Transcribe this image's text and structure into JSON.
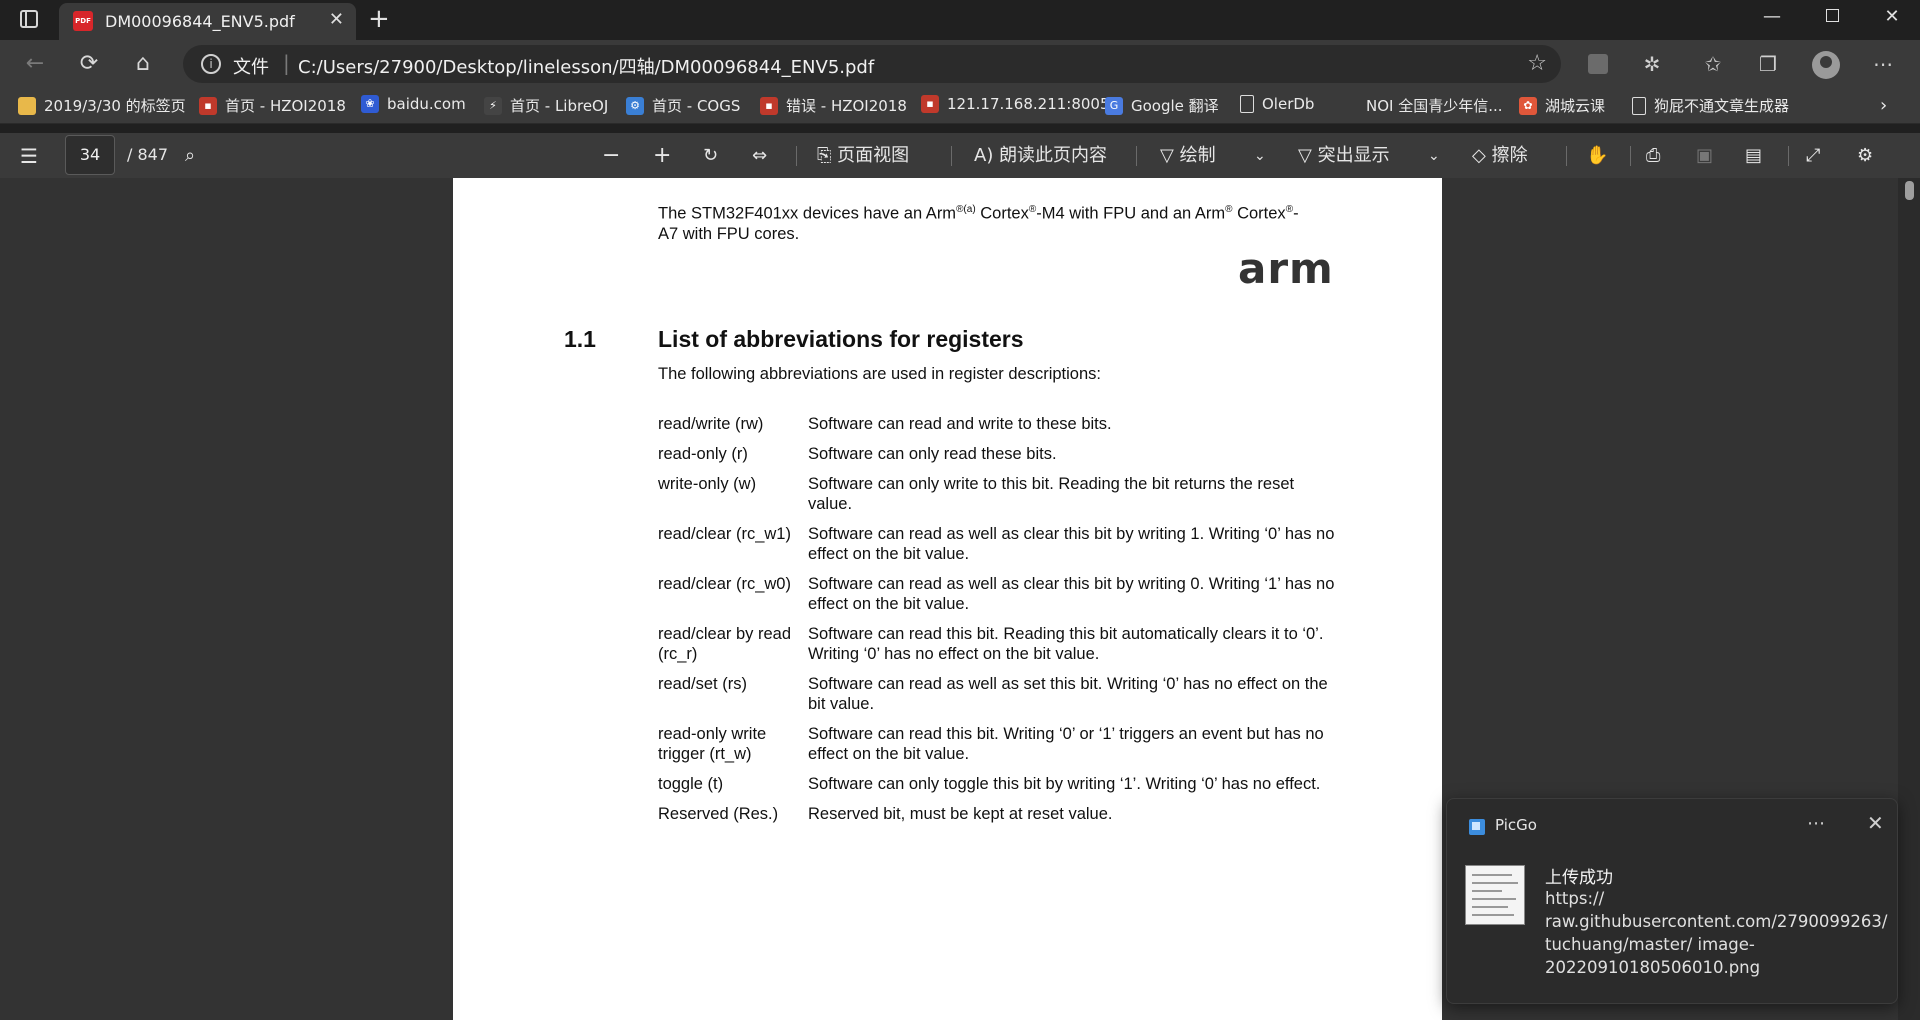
{
  "browser": {
    "tab_title": "DM00096844_ENV5.pdf",
    "address_scheme_label": "文件",
    "address_url": "C:/Users/27900/Desktop/linelesson/四轴/DM00096844_ENV5.pdf"
  },
  "bookmarks": [
    {
      "label": "2019/3/30 的标签页",
      "icon": "folder-icon",
      "color": "#e8b84a"
    },
    {
      "label": "首页 - HZOI2018",
      "icon": "site-favicon",
      "color": "#c0392b"
    },
    {
      "label": "baidu.com",
      "icon": "baidu-icon",
      "color": "#2f5bd3"
    },
    {
      "label": "首页 - LibreOJ",
      "icon": "libreoj-icon",
      "color": "#444444"
    },
    {
      "label": "首页 - COGS",
      "icon": "gear-icon",
      "color": "#3a7fd5"
    },
    {
      "label": "错误 - HZOI2018",
      "icon": "site-favicon",
      "color": "#c0392b"
    },
    {
      "label": "121.17.168.211:8005",
      "icon": "site-favicon",
      "color": "#c0392b"
    },
    {
      "label": "Google 翻译",
      "icon": "google-translate-icon",
      "color": "#4a7be0"
    },
    {
      "label": "OlerDb",
      "icon": "document-icon",
      "color": "#3a3a3a"
    },
    {
      "label": "NOI 全国青少年信...",
      "icon": "noi-icon",
      "color": "#3a3a3a"
    },
    {
      "label": "湖城云课",
      "icon": "hucheng-icon",
      "color": "#e0573a"
    },
    {
      "label": "狗屁不通文章生成器",
      "icon": "document-icon",
      "color": "#3a3a3a"
    }
  ],
  "pdf_toolbar": {
    "current_page": "34",
    "total_pages": "/ 847",
    "page_view_label": "页面视图",
    "read_aloud_label": "朗读此页内容",
    "draw_label": "绘制",
    "highlight_label": "突出显示",
    "erase_label": "擦除"
  },
  "document": {
    "intro_line1": "The STM32F401xx devices have an Arm",
    "intro_sup1": "®(a)",
    "intro_mid1": " Cortex",
    "intro_sup2": "®",
    "intro_mid2": "-M4 with FPU and an Arm",
    "intro_sup3": "®",
    "intro_mid3": " Cortex",
    "intro_sup4": "®",
    "intro_end": "-",
    "intro_line2": "A7 with FPU cores.",
    "logo_text": "arm",
    "section_number": "1.1",
    "section_title": "List of abbreviations for registers",
    "section_intro": "The following abbreviations are used in register descriptions:",
    "abbreviations": [
      {
        "term": "read/write (rw)",
        "desc": "Software can read and write to these bits."
      },
      {
        "term": "read-only (r)",
        "desc": "Software can only read these bits."
      },
      {
        "term": "write-only (w)",
        "desc": "Software can only write to this bit. Reading the bit returns the reset value."
      },
      {
        "term": "read/clear (rc_w1)",
        "desc": "Software can read as well as clear this bit by writing 1. Writing ‘0’ has no effect on the bit value."
      },
      {
        "term": "read/clear (rc_w0)",
        "desc": "Software can read as well as clear this bit by writing 0. Writing ‘1’ has no effect on the bit value."
      },
      {
        "term": "read/clear by read (rc_r)",
        "desc": "Software can read this bit. Reading this bit automatically clears it to ‘0’. Writing ‘0’ has no effect on the bit value."
      },
      {
        "term": "read/set (rs)",
        "desc": "Software can read as well as set this bit. Writing ‘0’ has no effect on the bit value."
      },
      {
        "term": "read-only write trigger (rt_w)",
        "desc": "Software can read this bit. Writing ‘0’ or ‘1’ triggers an event but has no effect on the bit value."
      },
      {
        "term": "toggle (t)",
        "desc": "Software can only toggle this bit by writing ‘1’. Writing ‘0’ has no effect."
      },
      {
        "term": "Reserved (Res.)",
        "desc": "Reserved bit, must be kept at reset value."
      }
    ]
  },
  "toast": {
    "app_name": "PicGo",
    "title": "上传成功",
    "body": "https:// raw.githubusercontent.com/2790099263/ tuchuang/master/ image-20220910180506010.png"
  }
}
